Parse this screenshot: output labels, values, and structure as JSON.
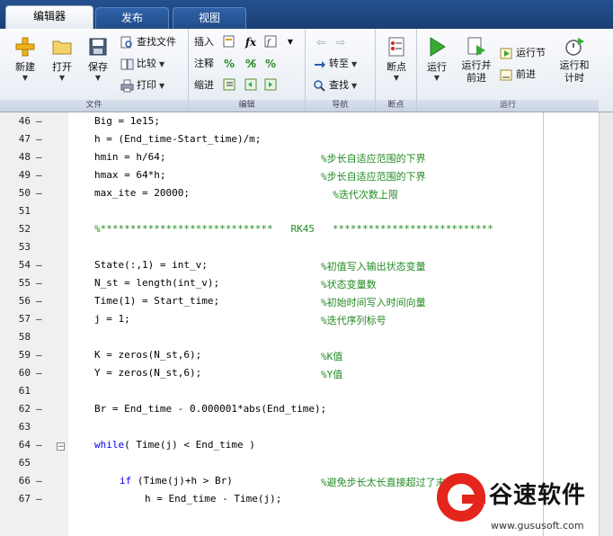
{
  "tabs": [
    {
      "label": "编辑器",
      "active": true
    },
    {
      "label": "发布",
      "active": false
    },
    {
      "label": "视图",
      "active": false
    }
  ],
  "ribbon": {
    "file": {
      "group_label": "文件",
      "new": "新建",
      "open": "打开",
      "save": "保存",
      "find_files": "查找文件",
      "compare": "比较",
      "print": "打印"
    },
    "edit": {
      "group_label": "编辑",
      "insert": "插入",
      "comment": "注释",
      "indent": "缩进",
      "fx": "fx"
    },
    "navigate": {
      "group_label": "导航",
      "goto": "转至",
      "find": "查找"
    },
    "breakpoints": {
      "group_label": "断点",
      "breakpoints": "断点"
    },
    "run": {
      "group_label": "运行",
      "run": "运行",
      "run_advance_1": "运行并",
      "run_advance_2": "前进",
      "run_section": "运行节",
      "advance": "前进",
      "run_time_1": "运行和",
      "run_time_2": "计时"
    }
  },
  "code_lines": [
    {
      "num": "46",
      "dash": true,
      "code": "Big = 1e15;",
      "comment": ""
    },
    {
      "num": "47",
      "dash": true,
      "code": "h = (End_time-Start_time)/m;",
      "comment": ""
    },
    {
      "num": "48",
      "dash": true,
      "code": "hmin = h/64;",
      "comment": "%步长自适应范围的下界"
    },
    {
      "num": "49",
      "dash": true,
      "code": "hmax = 64*h;",
      "comment": "%步长自适应范围的下界"
    },
    {
      "num": "50",
      "dash": true,
      "code": "max_ite = 20000;",
      "comment": "  %迭代次数上限"
    },
    {
      "num": "51",
      "dash": false,
      "code": "",
      "comment": ""
    },
    {
      "num": "52",
      "dash": false,
      "code": "",
      "comment": "%*****************************   RK45   ***************************"
    },
    {
      "num": "53",
      "dash": false,
      "code": "",
      "comment": ""
    },
    {
      "num": "54",
      "dash": true,
      "code": "State(:,1) = int_v;",
      "comment": "%初值写入输出状态变量"
    },
    {
      "num": "55",
      "dash": true,
      "code": "N_st = length(int_v);",
      "comment": "%状态变量数"
    },
    {
      "num": "56",
      "dash": true,
      "code": "Time(1) = Start_time;",
      "comment": "%初始时间写入时间向量"
    },
    {
      "num": "57",
      "dash": true,
      "code": "j = 1;",
      "comment": "%迭代序列标号"
    },
    {
      "num": "58",
      "dash": false,
      "code": "",
      "comment": ""
    },
    {
      "num": "59",
      "dash": true,
      "code": "K = zeros(N_st,6);",
      "comment": "%K值"
    },
    {
      "num": "60",
      "dash": true,
      "code": "Y = zeros(N_st,6);",
      "comment": "%Y值"
    },
    {
      "num": "61",
      "dash": false,
      "code": "",
      "comment": ""
    },
    {
      "num": "62",
      "dash": true,
      "code": "Br = End_time - 0.000001*abs(End_time);",
      "comment": ""
    },
    {
      "num": "63",
      "dash": false,
      "code": "",
      "comment": ""
    },
    {
      "num": "64",
      "dash": true,
      "fold": true,
      "keyword": "while",
      "code": "( Time(j) < End_time )",
      "comment": ""
    },
    {
      "num": "65",
      "dash": false,
      "code": "",
      "comment": ""
    },
    {
      "num": "66",
      "dash": true,
      "indent": 1,
      "keyword": "if",
      "code": " (Time(j)+h > Br)",
      "comment": "%避免步长太长直接超过了末端时间"
    },
    {
      "num": "67",
      "dash": true,
      "indent": 2,
      "code": "h = End_time - Time(j);",
      "comment": ""
    }
  ],
  "watermark": {
    "title": "谷速软件",
    "url": "www.gususoft.com"
  },
  "colors": {
    "tab_strip": "#1f4a85",
    "comment": "#228b22",
    "keyword": "#0000ff",
    "watermark_red": "#e4251b"
  }
}
